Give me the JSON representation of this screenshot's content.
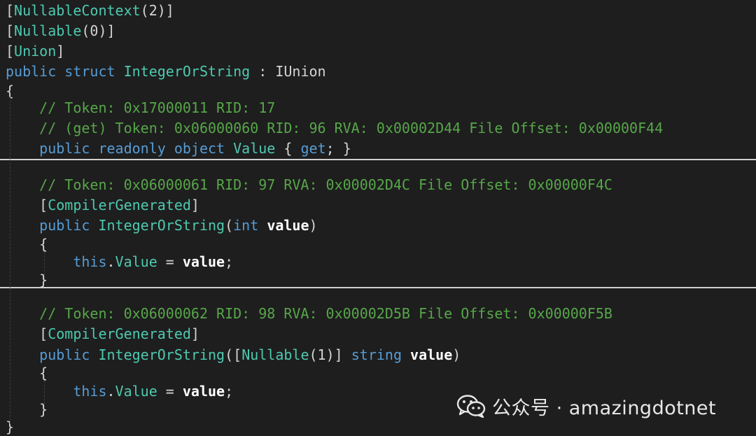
{
  "code": {
    "lines": [
      [
        [
          "plain",
          "["
        ],
        [
          "type",
          "NullableContext"
        ],
        [
          "plain",
          "(2)]"
        ]
      ],
      [
        [
          "plain",
          "["
        ],
        [
          "type",
          "Nullable"
        ],
        [
          "plain",
          "(0)]"
        ]
      ],
      [
        [
          "plain",
          "["
        ],
        [
          "type",
          "Union"
        ],
        [
          "plain",
          "]"
        ]
      ],
      [
        [
          "kw",
          "public"
        ],
        [
          "plain",
          " "
        ],
        [
          "kw",
          "struct"
        ],
        [
          "plain",
          " "
        ],
        [
          "type",
          "IntegerOrString"
        ],
        [
          "plain",
          " : IUnion"
        ]
      ],
      [
        [
          "plain",
          "{"
        ]
      ],
      [
        [
          "comment",
          "    // Token: 0x17000011 RID: 17"
        ]
      ],
      [
        [
          "comment",
          "    // (get) Token: 0x06000060 RID: 96 RVA: 0x00002D44 File Offset: 0x00000F44"
        ]
      ],
      [
        [
          "plain",
          "    "
        ],
        [
          "kw",
          "public"
        ],
        [
          "plain",
          " "
        ],
        [
          "kw",
          "readonly"
        ],
        [
          "plain",
          " "
        ],
        [
          "kw",
          "object"
        ],
        [
          "plain",
          " "
        ],
        [
          "prop",
          "Value"
        ],
        [
          "plain",
          " { "
        ],
        [
          "kw",
          "get"
        ],
        [
          "plain",
          "; }"
        ]
      ],
      [
        [
          "comment",
          "    // Token: 0x06000061 RID: 97 RVA: 0x00002D4C File Offset: 0x00000F4C"
        ]
      ],
      [
        [
          "plain",
          "    ["
        ],
        [
          "type",
          "CompilerGenerated"
        ],
        [
          "plain",
          "]"
        ]
      ],
      [
        [
          "plain",
          "    "
        ],
        [
          "kw",
          "public"
        ],
        [
          "plain",
          " "
        ],
        [
          "type",
          "IntegerOrString"
        ],
        [
          "plain",
          "("
        ],
        [
          "kw",
          "int"
        ],
        [
          "plain",
          " "
        ],
        [
          "param",
          "value"
        ],
        [
          "plain",
          ")"
        ]
      ],
      [
        [
          "plain",
          "    {"
        ]
      ],
      [
        [
          "plain",
          "        "
        ],
        [
          "kw",
          "this"
        ],
        [
          "plain",
          "."
        ],
        [
          "prop",
          "Value"
        ],
        [
          "plain",
          " = "
        ],
        [
          "param",
          "value"
        ],
        [
          "plain",
          ";"
        ]
      ],
      [
        [
          "plain",
          "    }"
        ]
      ],
      [
        [
          "comment",
          "    // Token: 0x06000062 RID: 98 RVA: 0x00002D5B File Offset: 0x00000F5B"
        ]
      ],
      [
        [
          "plain",
          "    ["
        ],
        [
          "type",
          "CompilerGenerated"
        ],
        [
          "plain",
          "]"
        ]
      ],
      [
        [
          "plain",
          "    "
        ],
        [
          "kw",
          "public"
        ],
        [
          "plain",
          " "
        ],
        [
          "type",
          "IntegerOrString"
        ],
        [
          "plain",
          "(["
        ],
        [
          "type",
          "Nullable"
        ],
        [
          "plain",
          "(1)] "
        ],
        [
          "kw",
          "string"
        ],
        [
          "plain",
          " "
        ],
        [
          "param",
          "value"
        ],
        [
          "plain",
          ")"
        ]
      ],
      [
        [
          "plain",
          "    {"
        ]
      ],
      [
        [
          "plain",
          "        "
        ],
        [
          "kw",
          "this"
        ],
        [
          "plain",
          "."
        ],
        [
          "prop",
          "Value"
        ],
        [
          "plain",
          " = "
        ],
        [
          "param",
          "value"
        ],
        [
          "plain",
          ";"
        ]
      ],
      [
        [
          "plain",
          "    }"
        ]
      ],
      [
        [
          "plain",
          "}"
        ]
      ]
    ]
  },
  "watermark": {
    "icon": "wechat-icon",
    "text": "公众号 · amazingdotnet"
  },
  "colors": {
    "background": "#1e1e1e",
    "keyword": "#569cd6",
    "type": "#4ec9b0",
    "comment": "#57a64a",
    "plain": "#d4d4d4",
    "parameter": "#ffffff",
    "separator": "#cfcfcf"
  }
}
